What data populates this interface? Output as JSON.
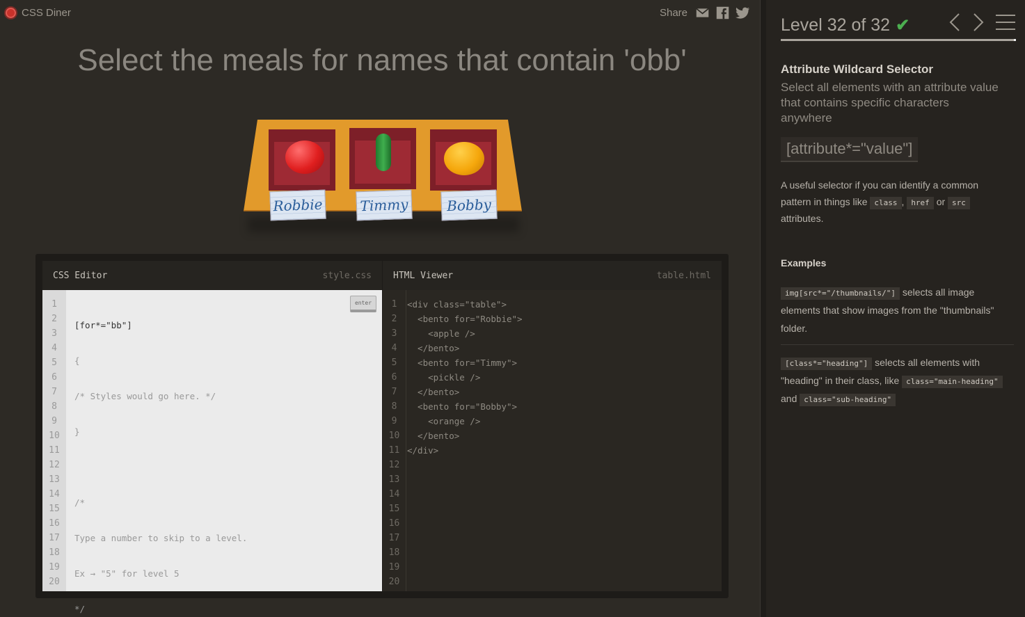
{
  "app": {
    "name": "CSS Diner"
  },
  "share": {
    "label": "Share",
    "icons": [
      "email-icon",
      "facebook-icon",
      "twitter-icon"
    ]
  },
  "order": "Select the meals for names that contain 'obb'",
  "table": {
    "bentos": [
      {
        "name": "Robbie",
        "food": "apple"
      },
      {
        "name": "Timmy",
        "food": "pickle"
      },
      {
        "name": "Bobby",
        "food": "orange"
      }
    ]
  },
  "css_editor": {
    "title": "CSS Editor",
    "file": "style.css",
    "enter_label": "enter",
    "input_value": "[for*=\"bb\"]",
    "lines": [
      "{",
      "/* Styles would go here. */",
      "}",
      "",
      "/*",
      "Type a number to skip to a level.",
      "Ex → \"5\" for level 5",
      "*/"
    ],
    "line_numbers": [
      "1",
      "2",
      "3",
      "4",
      "5",
      "6",
      "7",
      "8",
      "9",
      "10",
      "11",
      "12",
      "13",
      "14",
      "15",
      "16",
      "17",
      "18",
      "19",
      "20"
    ]
  },
  "html_viewer": {
    "title": "HTML Viewer",
    "file": "table.html",
    "lines": [
      "<div class=\"table\">",
      "  <bento for=\"Robbie\">",
      "    <apple />",
      "  </bento>",
      "  <bento for=\"Timmy\">",
      "    <pickle />",
      "  </bento>",
      "  <bento for=\"Bobby\">",
      "    <orange />",
      "  </bento>",
      "</div>"
    ],
    "line_numbers": [
      "1",
      "2",
      "3",
      "4",
      "5",
      "6",
      "7",
      "8",
      "9",
      "10",
      "11",
      "12",
      "13",
      "14",
      "15",
      "16",
      "17",
      "18",
      "19",
      "20"
    ]
  },
  "sidebar": {
    "level_text": "Level 32 of 32",
    "completed_mark": "✔",
    "progress": 1.0,
    "selector_name": "Attribute Wildcard Selector",
    "title": "Select all elements with an attribute value that contains specific characters anywhere",
    "syntax": "[attribute*=\"value\"]",
    "hint": {
      "text1": "A useful selector if you can identify a common pattern in things like ",
      "tag1": "class",
      "sep1": ", ",
      "tag2": "href",
      "sep2": " or ",
      "tag3": "src",
      "text2": " attributes."
    },
    "examples_title": "Examples",
    "examples": [
      {
        "code": "img[src*=\"/thumbnails/\"]",
        "text": " selects all image elements that show images from the \"thumbnails\" folder."
      },
      {
        "code": "[class*=\"heading\"]",
        "text": " selects all elements with \"heading\" in their class, like ",
        "code2": "class=\"main-heading\"",
        "and": " and ",
        "code3": "class=\"sub-heading\""
      }
    ]
  },
  "colors": {
    "background": "#2d2a25",
    "sidebar": "#26231f",
    "apple": "#e01f1f",
    "pickle": "#3fae4e",
    "orange": "#f5a70c",
    "check": "#4caf50"
  }
}
